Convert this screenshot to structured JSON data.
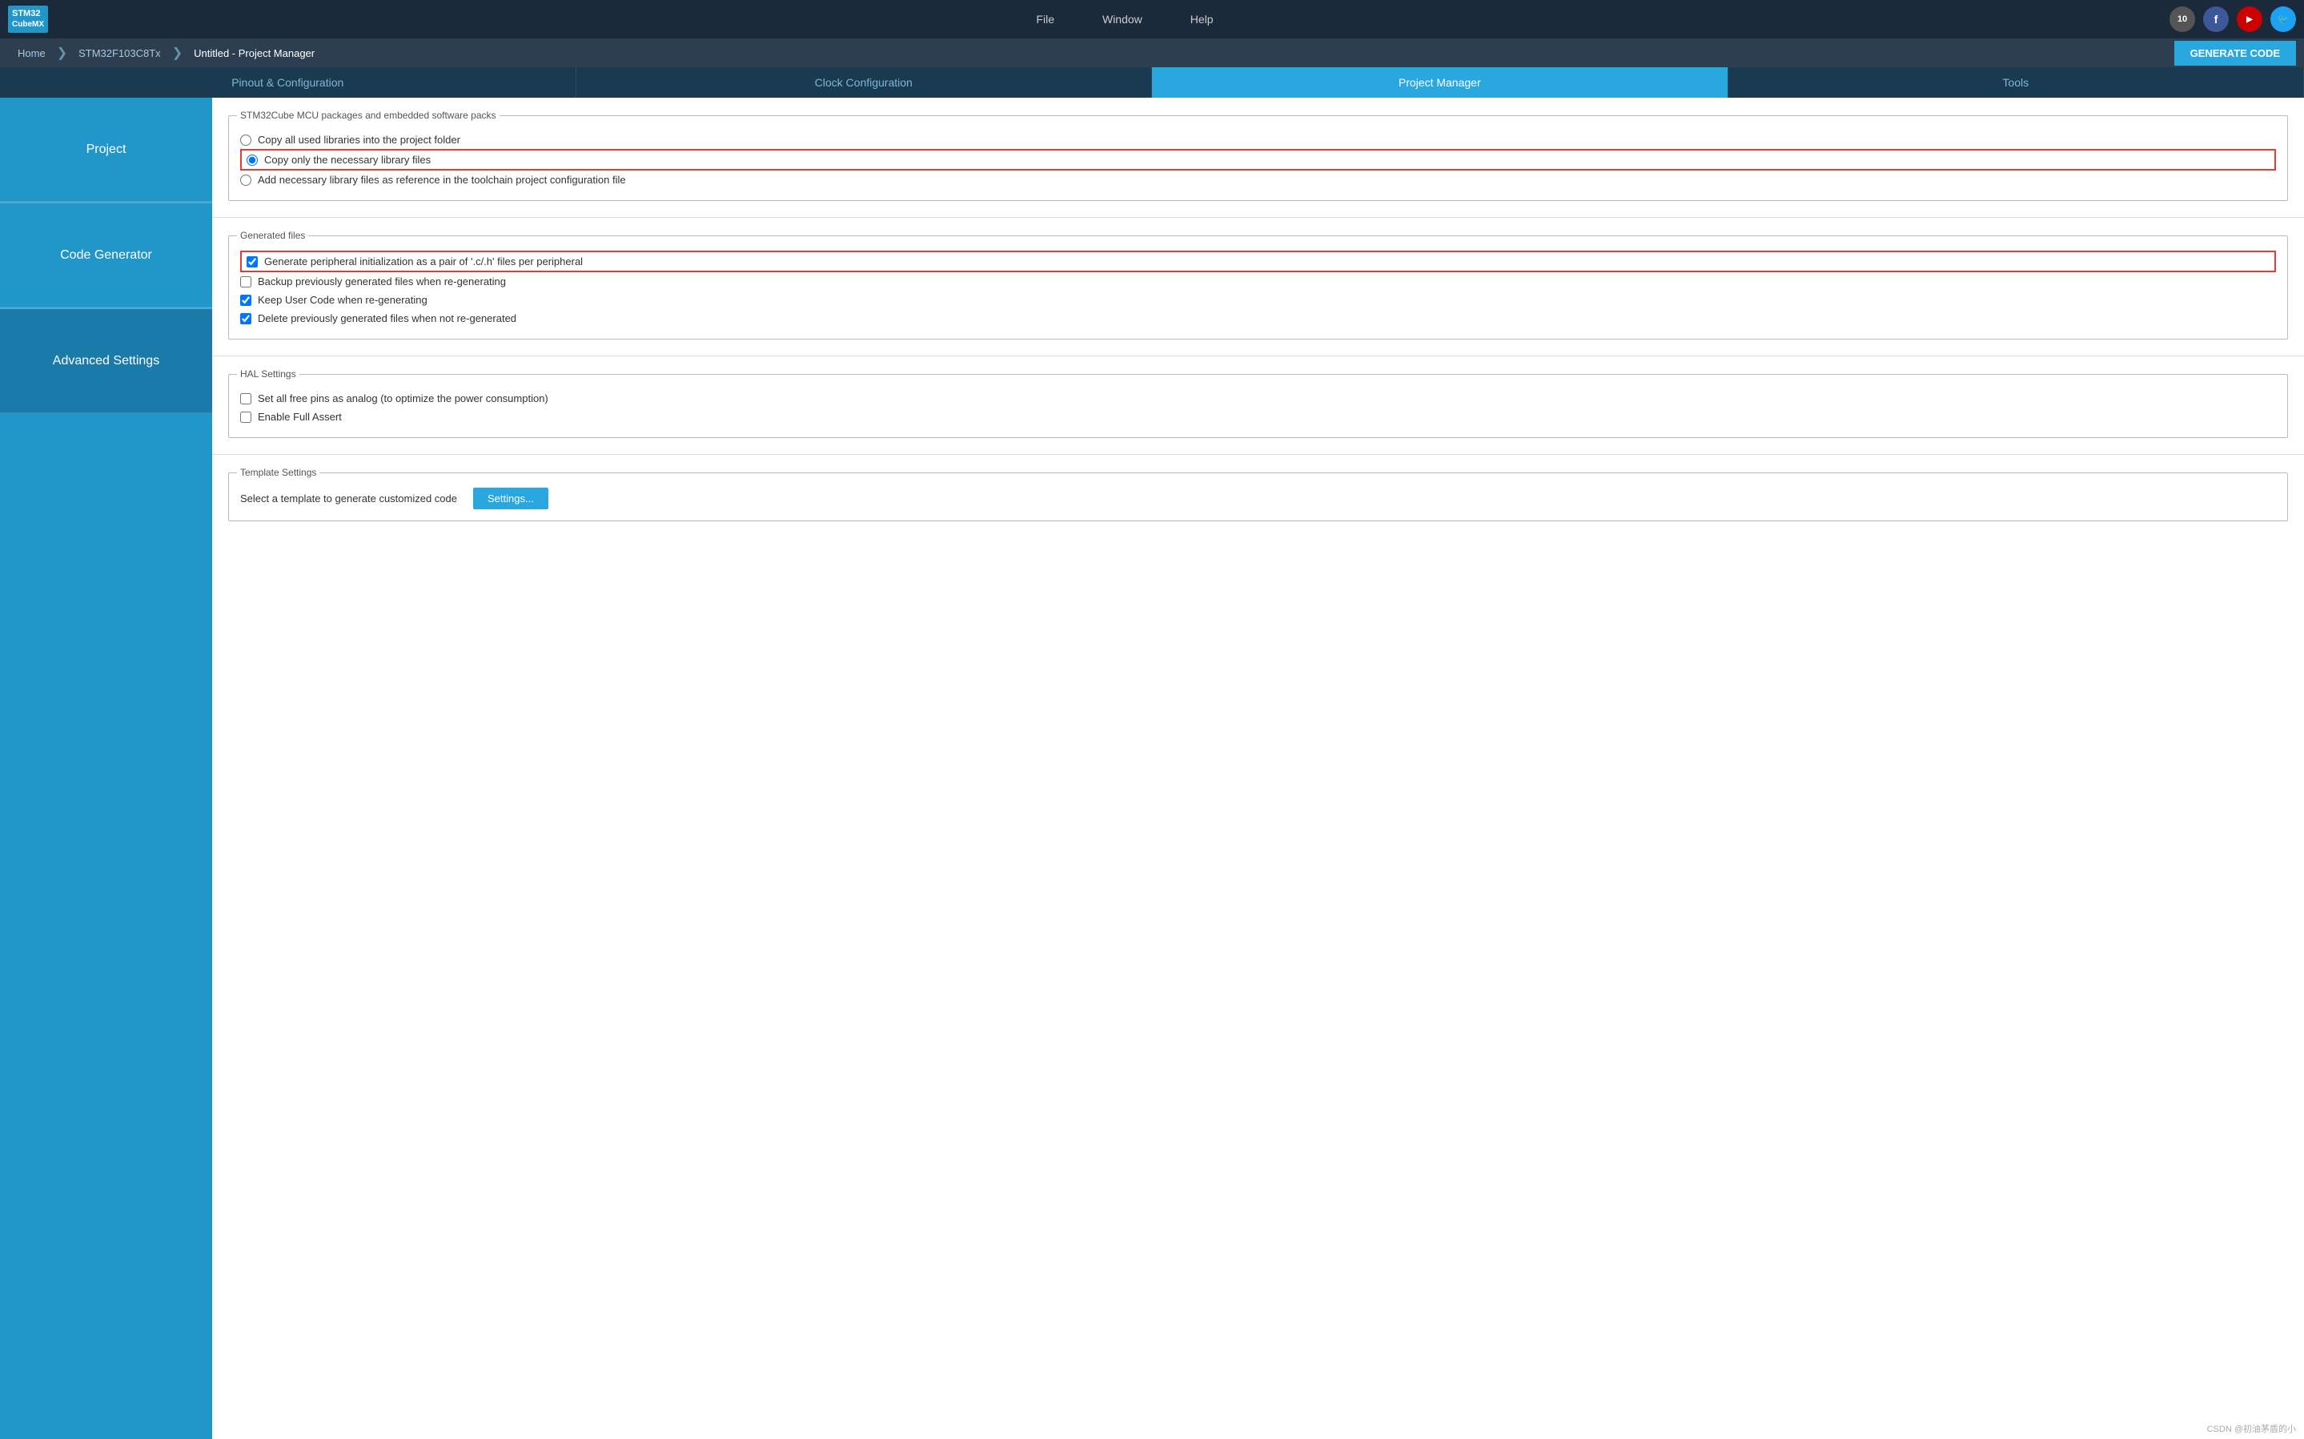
{
  "app": {
    "logo_line1": "STM32",
    "logo_line2": "CubeMX"
  },
  "menu": {
    "items": [
      "File",
      "Window",
      "Help"
    ]
  },
  "breadcrumb": {
    "home": "Home",
    "board": "STM32F103C8Tx",
    "project": "Untitled - Project Manager"
  },
  "generate_btn": "GENERATE CODE",
  "tabs": [
    {
      "label": "Pinout & Configuration",
      "active": false
    },
    {
      "label": "Clock Configuration",
      "active": false
    },
    {
      "label": "Project Manager",
      "active": true
    },
    {
      "label": "Tools",
      "active": false
    }
  ],
  "sidebar": {
    "items": [
      {
        "label": "Project",
        "active": false
      },
      {
        "label": "Code Generator",
        "active": false
      },
      {
        "label": "Advanced Settings",
        "active": true
      }
    ]
  },
  "mcu_section": {
    "title": "STM32Cube MCU packages and embedded software packs",
    "options": [
      {
        "label": "Copy all used libraries into the project folder",
        "checked": false
      },
      {
        "label": "Copy only the necessary library files",
        "checked": true
      },
      {
        "label": "Add necessary library files as reference in the toolchain project configuration file",
        "checked": false
      }
    ]
  },
  "generated_files": {
    "title": "Generated files",
    "options": [
      {
        "label": "Generate peripheral initialization as a pair of '.c/.h' files per peripheral",
        "checked": true
      },
      {
        "label": "Backup previously generated files when re-generating",
        "checked": false
      },
      {
        "label": "Keep User Code when re-generating",
        "checked": true
      },
      {
        "label": "Delete previously generated files when not re-generated",
        "checked": true
      }
    ]
  },
  "hal_settings": {
    "title": "HAL Settings",
    "options": [
      {
        "label": "Set all free pins as analog (to optimize the power consumption)",
        "checked": false
      },
      {
        "label": "Enable Full Assert",
        "checked": false
      }
    ]
  },
  "template_settings": {
    "title": "Template Settings",
    "label": "Select a template to generate customized code",
    "button": "Settings..."
  },
  "watermark": "CSDN @初油茅盾的小"
}
